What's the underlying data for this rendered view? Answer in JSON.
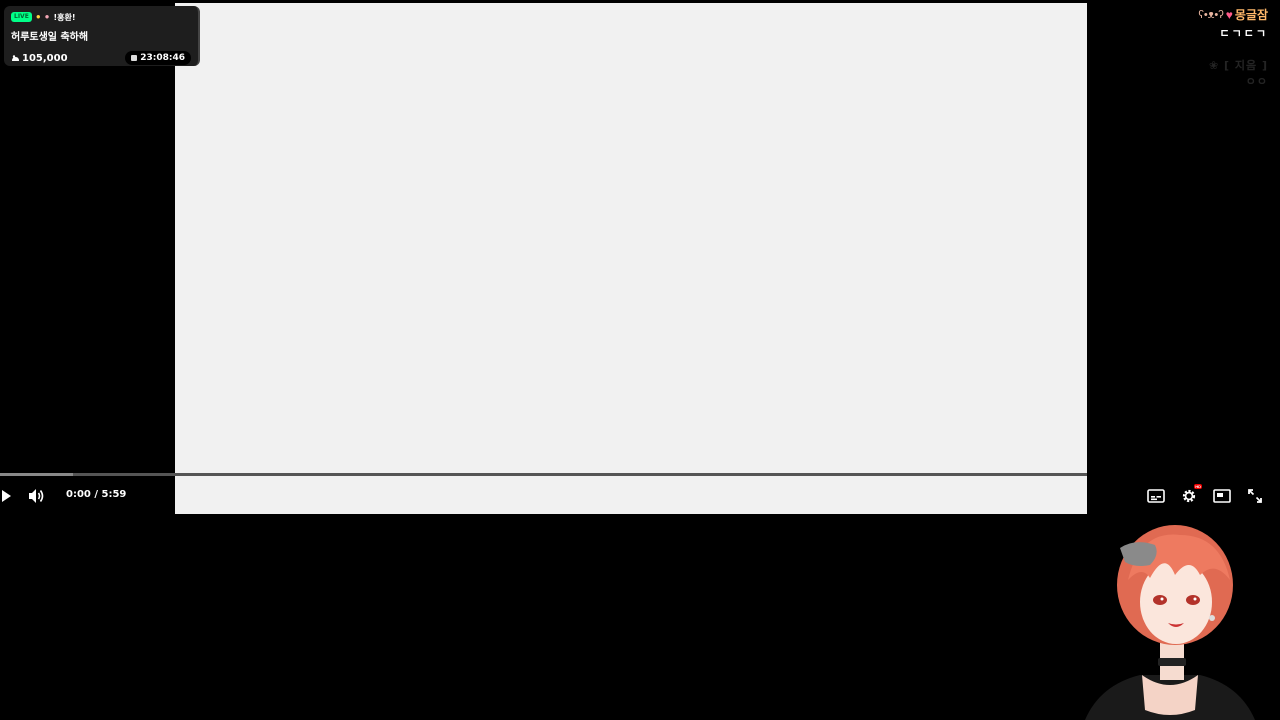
{
  "info_card": {
    "live_badge": "LIVE",
    "tag": "!홍환!",
    "title": "허루토생일 축하해",
    "viewers": "105,000",
    "uptime": "23:08:46"
  },
  "chat": {
    "username": "몽글잠",
    "message": "ㄷㄱㄷㄱ",
    "faded_line1": "❀ [ 지음 ]",
    "faded_line2": "ㅇㅇ"
  },
  "player": {
    "time_display": "0:00 / 5:59",
    "progress_played": 0,
    "progress_buffered": 0.067,
    "hd_label": "HD"
  },
  "icons": {
    "play": "play-icon",
    "volume": "volume-icon",
    "captions": "captions-icon",
    "settings": "gear-icon",
    "miniplayer": "miniplayer-icon",
    "fullscreen": "fullscreen-icon"
  },
  "colors": {
    "panel_bg": "#f1f1f1",
    "page_bg": "#000000",
    "username": "#ffb86a",
    "progress_played": "#ff0000"
  }
}
